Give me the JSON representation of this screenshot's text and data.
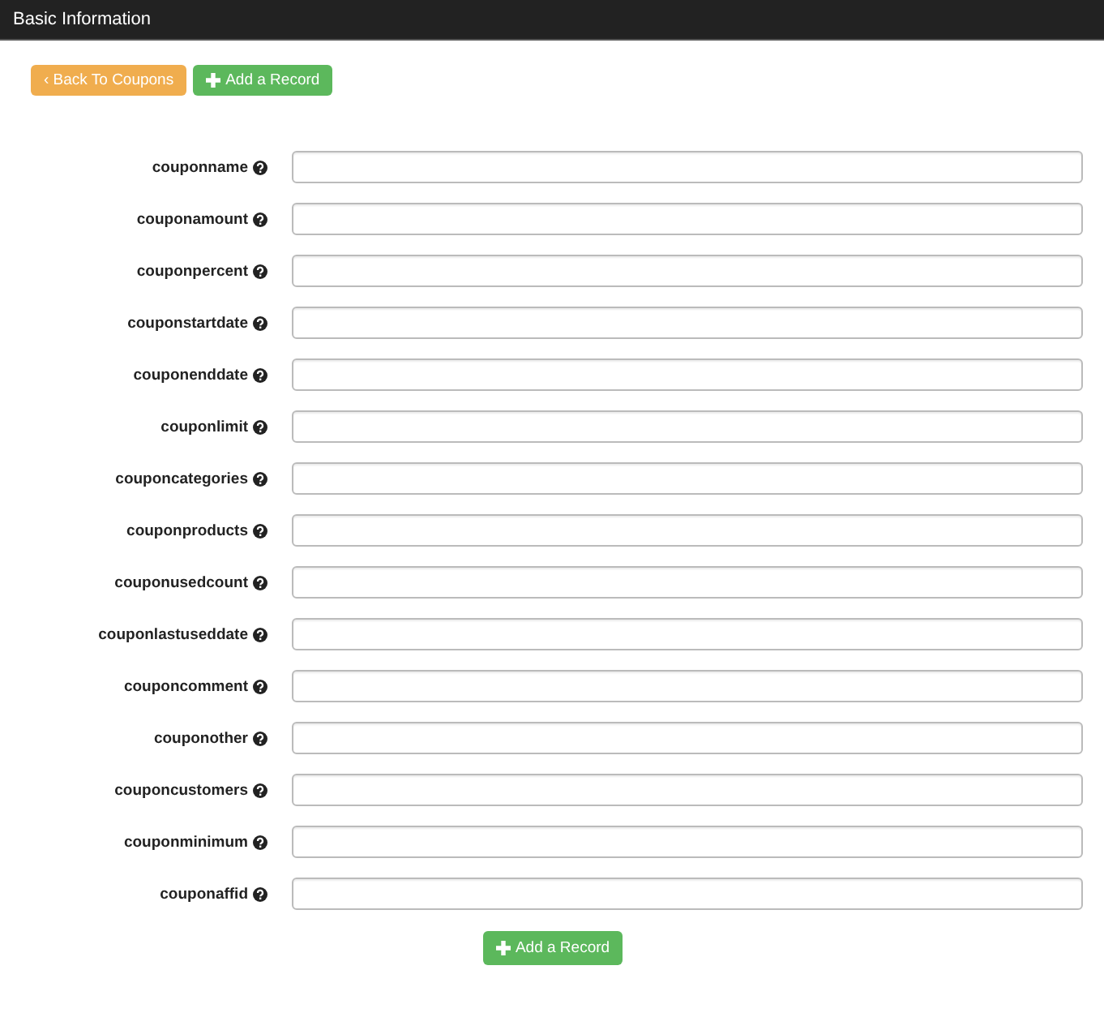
{
  "header": {
    "title": "Basic Information"
  },
  "top_buttons": [
    {
      "label": "‹ Back To Coupons",
      "kind": "back"
    },
    {
      "label": "Add a Record",
      "kind": "add"
    }
  ],
  "fields": [
    {
      "label": "couponname"
    },
    {
      "label": "couponamount"
    },
    {
      "label": "couponpercent"
    },
    {
      "label": "couponstartdate"
    },
    {
      "label": "couponenddate"
    },
    {
      "label": "couponlimit"
    },
    {
      "label": "couponcategories"
    },
    {
      "label": "couponproducts"
    },
    {
      "label": "couponusedcount"
    },
    {
      "label": "couponlastuseddate"
    },
    {
      "label": "couponcomment"
    },
    {
      "label": "couponother"
    },
    {
      "label": "couponcustomers"
    },
    {
      "label": "couponminimum"
    },
    {
      "label": "couponaffid"
    }
  ],
  "bottom_button": {
    "label": "Add a Record",
    "kind": "add"
  }
}
